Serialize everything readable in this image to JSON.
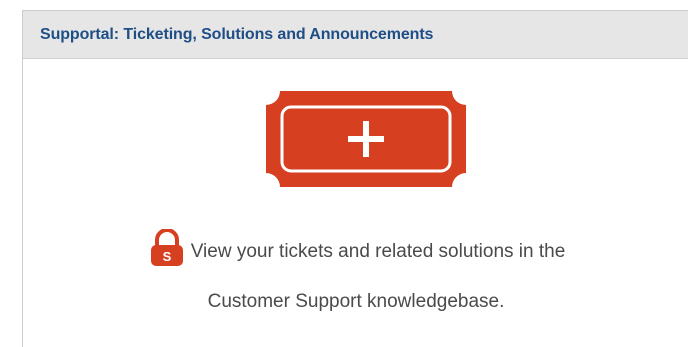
{
  "panel": {
    "title": "Supportal: Ticketing, Solutions and Announcements"
  },
  "new_ticket": {
    "icon": "ticket-plus-icon",
    "color": "#d64021"
  },
  "message": {
    "lock_icon": "lock-icon",
    "lock_letter": "S",
    "line1": "View your tickets and related solutions in the",
    "line2": "Customer Support knowledgebase."
  }
}
